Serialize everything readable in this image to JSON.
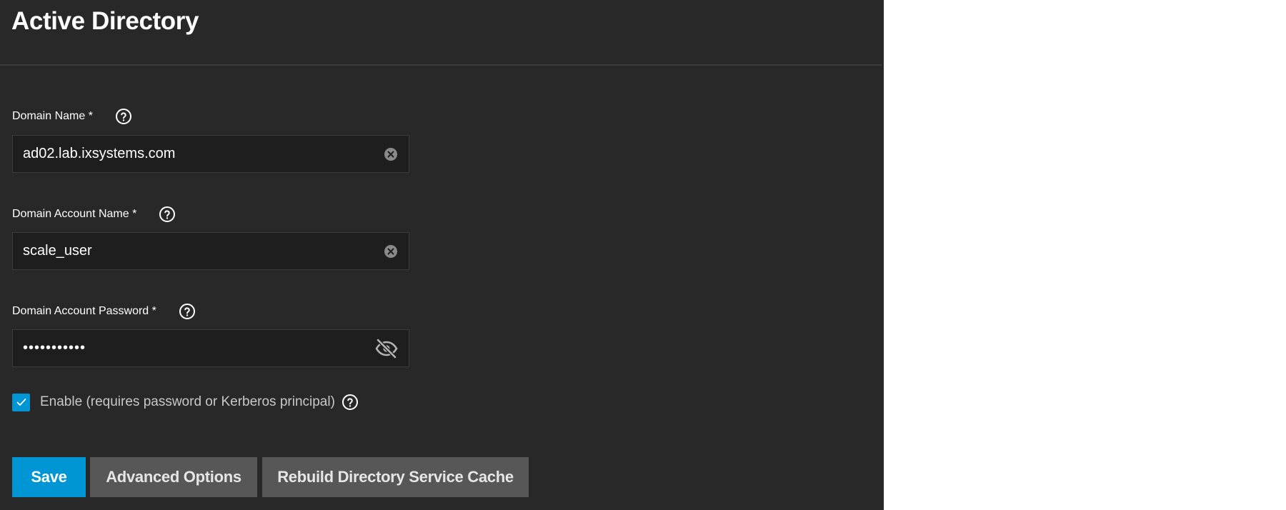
{
  "page": {
    "title": "Active Directory"
  },
  "fields": {
    "domain_name": {
      "label": "Domain Name *",
      "value": "ad02.lab.ixsystems.com"
    },
    "account_name": {
      "label": "Domain Account Name *",
      "value": "scale_user"
    },
    "account_password": {
      "label": "Domain Account Password *",
      "value": "•••••••••••"
    }
  },
  "enable": {
    "label": "Enable (requires password or Kerberos principal)",
    "checked": true
  },
  "buttons": {
    "save": "Save",
    "advanced": "Advanced Options",
    "rebuild": "Rebuild Directory Service Cache"
  },
  "colors": {
    "panel_bg": "#282828",
    "input_bg": "#1e1e1e",
    "accent": "#0095d5",
    "secondary_button": "#575757"
  },
  "icons": {
    "help": "help-circle-icon",
    "clear": "clear-circle-icon",
    "visibility_off": "eye-off-icon",
    "check": "check-icon"
  }
}
